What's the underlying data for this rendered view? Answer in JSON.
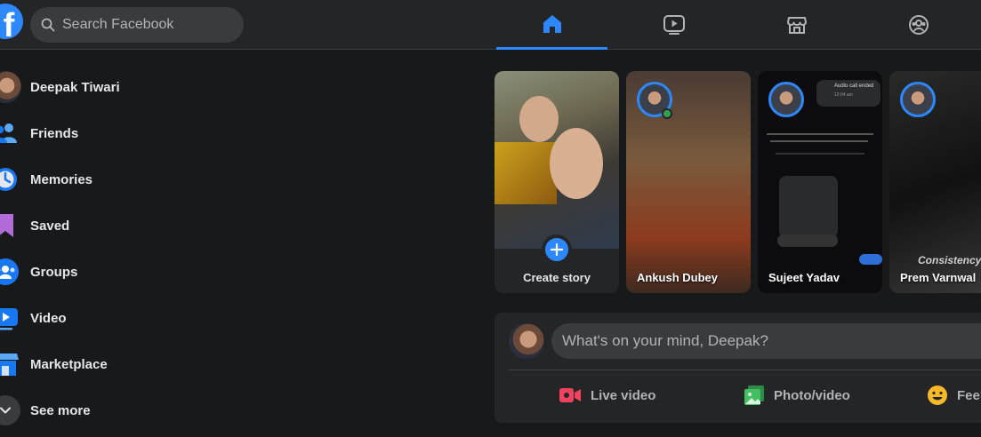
{
  "header": {
    "logo_letter": "f",
    "search_placeholder": "Search Facebook",
    "nav_tabs": [
      {
        "name": "home",
        "icon": "home-icon",
        "active": true
      },
      {
        "name": "watch",
        "icon": "watch-icon",
        "active": false
      },
      {
        "name": "marketplace",
        "icon": "marketplace-icon",
        "active": false
      },
      {
        "name": "groups",
        "icon": "groups-icon",
        "active": false
      }
    ]
  },
  "sidebar": {
    "items": [
      {
        "label": "Deepak Tiwari",
        "icon": "profile-avatar"
      },
      {
        "label": "Friends",
        "icon": "friends-icon"
      },
      {
        "label": "Memories",
        "icon": "memories-icon"
      },
      {
        "label": "Saved",
        "icon": "saved-icon"
      },
      {
        "label": "Groups",
        "icon": "groups-icon"
      },
      {
        "label": "Video",
        "icon": "video-icon"
      },
      {
        "label": "Marketplace",
        "icon": "marketplace-icon"
      },
      {
        "label": "See more",
        "icon": "chevron-down-icon"
      }
    ]
  },
  "stories": {
    "create_label": "Create story",
    "items": [
      {
        "name": "Ankush Dubey"
      },
      {
        "name": "Sujeet Yadav"
      },
      {
        "name": "Prem Varnwal"
      }
    ],
    "sujeet_chat": {
      "call_title": "Audio call ended",
      "call_time": "12:04 am"
    },
    "prem_overlay": "Consistency"
  },
  "composer": {
    "placeholder": "What's on your mind, Deepak?",
    "actions": [
      {
        "label": "Live video",
        "icon": "live-video-icon"
      },
      {
        "label": "Photo/video",
        "icon": "photo-icon"
      },
      {
        "label": "Feel",
        "icon": "feeling-icon"
      }
    ]
  },
  "colors": {
    "background": "#18191a",
    "surface": "#242526",
    "accent": "#2d88ff",
    "live_red": "#f3425f",
    "photo_green": "#45bd62",
    "feeling_yellow": "#f7b928"
  }
}
